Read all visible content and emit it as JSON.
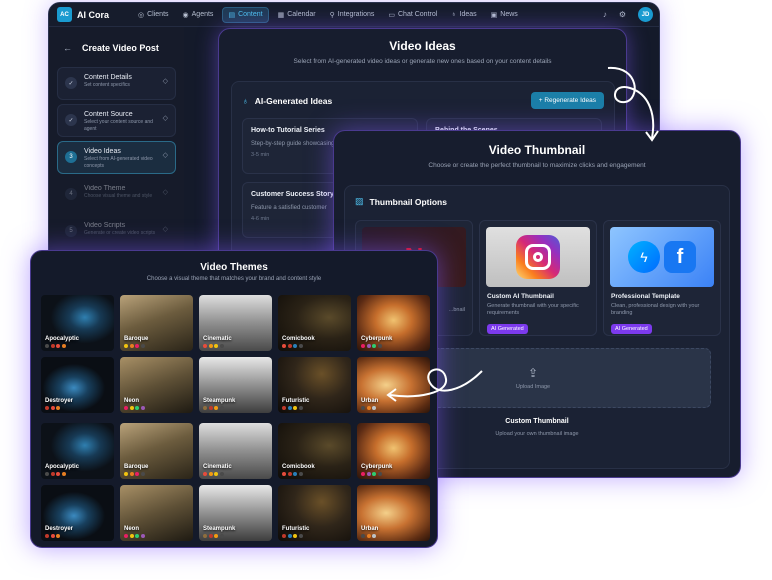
{
  "app": {
    "logo": "AC",
    "brand": "AI Cora",
    "nav": [
      {
        "label": "Clients",
        "icon": "users-icon",
        "glyph": "◎"
      },
      {
        "label": "Agents",
        "icon": "bot-icon",
        "glyph": "◉"
      },
      {
        "label": "Content",
        "icon": "file-icon",
        "glyph": "▤",
        "active": true
      },
      {
        "label": "Calendar",
        "icon": "calendar-icon",
        "glyph": "▦"
      },
      {
        "label": "Integrations",
        "icon": "plug-icon",
        "glyph": "⚲"
      },
      {
        "label": "Chat Control",
        "icon": "chat-icon",
        "glyph": "▭"
      },
      {
        "label": "Ideas",
        "icon": "lightbulb-icon",
        "glyph": "♁"
      },
      {
        "label": "News",
        "icon": "news-icon",
        "glyph": "▣"
      }
    ],
    "avatar": "JD"
  },
  "sidebar": {
    "title": "Create Video Post",
    "steps": [
      {
        "num": "✓",
        "title": "Content Details",
        "sub": "Set content specifics",
        "state": "done"
      },
      {
        "num": "✓",
        "title": "Content Source",
        "sub": "Select your content source and agent",
        "state": "done"
      },
      {
        "num": "3",
        "title": "Video Ideas",
        "sub": "Select from AI-generated video concepts",
        "state": "active"
      },
      {
        "num": "4",
        "title": "Video Theme",
        "sub": "Choose visual theme and style",
        "state": "pending"
      },
      {
        "num": "5",
        "title": "Video Scripts",
        "sub": "Generate or create video scripts",
        "state": "pending"
      }
    ]
  },
  "ideas": {
    "title": "Video Ideas",
    "subtitle": "Select from AI-generated video ideas or generate new ones based on your content details",
    "section_title": "AI-Generated Ideas",
    "regenerate": "Regenerate Ideas",
    "cards": [
      {
        "title": "How-to Tutorial Series",
        "desc": "Step-by-step guide showcasing your product or service",
        "meta": "3-5 min"
      },
      {
        "title": "Behind the Scenes",
        "desc": "",
        "meta": ""
      },
      {
        "title": "Customer Success Story",
        "desc": "Feature a satisfied customer",
        "meta": "4-6 min"
      }
    ]
  },
  "thumbnail": {
    "title": "Video Thumbnail",
    "subtitle": "Choose or create the perfect thumbnail to maximize clicks and engagement",
    "section_title": "Thumbnail Options",
    "options": [
      {
        "title": "",
        "desc": "...bnail",
        "badge": ""
      },
      {
        "title": "Custom AI Thumbnail",
        "desc": "Generate thumbnail with your specific requirements",
        "badge": "AI Generated"
      },
      {
        "title": "Professional Template",
        "desc": "Clean, professional design with your branding",
        "badge": "AI Generated"
      }
    ],
    "upload_label": "Upload Image",
    "custom_title": "Custom Thumbnail",
    "custom_sub": "Upload your own thumbnail image"
  },
  "themes": {
    "title": "Video Themes",
    "subtitle": "Choose a visual theme that matches your brand and content style",
    "tiles": [
      {
        "label": "Apocalyptic",
        "style": "apocalyptic",
        "dots": [
          "#4a4a4a",
          "#c0392b",
          "#e74c3c",
          "#e67e22"
        ]
      },
      {
        "label": "Baroque",
        "style": "baroque",
        "dots": [
          "#f1c40f",
          "#e67e22",
          "#e91e63",
          "#4a4a4a"
        ]
      },
      {
        "label": "Cinematic",
        "style": "cinematic",
        "dots": [
          "#e74c3c",
          "#f39c12",
          "#f1c40f",
          "#4a4a4a"
        ]
      },
      {
        "label": "Comicbook",
        "style": "comicbook",
        "dots": [
          "#e74c3c",
          "#c0392b",
          "#2980b9",
          "#4a4a4a"
        ]
      },
      {
        "label": "Cyberpunk",
        "style": "cyberpunk",
        "dots": [
          "#e91e63",
          "#9b59b6",
          "#2ecc71",
          "#4a4a4a"
        ]
      },
      {
        "label": "Destroyer",
        "style": "destroyer",
        "dots": [
          "#c0392b",
          "#e74c3c",
          "#e67e22"
        ]
      },
      {
        "label": "Neon",
        "style": "neon",
        "dots": [
          "#e91e63",
          "#f1c40f",
          "#2ecc71",
          "#9b59b6"
        ]
      },
      {
        "label": "Steampunk",
        "style": "steampunk",
        "dots": [
          "#8e6e3e",
          "#c0392b",
          "#f39c12",
          "#4a4a4a"
        ]
      },
      {
        "label": "Futuristic",
        "style": "futuristic",
        "dots": [
          "#c0392b",
          "#2980b9",
          "#f1c40f",
          "#4a4a4a"
        ]
      },
      {
        "label": "Urban",
        "style": "urban",
        "dots": [
          "#4a4a4a",
          "#e67e22",
          "#bdc3c7"
        ]
      },
      {
        "label": "Apocalyptic",
        "style": "apocalyptic",
        "dots": [
          "#4a4a4a",
          "#c0392b",
          "#e74c3c",
          "#e67e22"
        ]
      },
      {
        "label": "Baroque",
        "style": "baroque",
        "dots": [
          "#f1c40f",
          "#e67e22",
          "#e91e63",
          "#4a4a4a"
        ]
      },
      {
        "label": "Cinematic",
        "style": "cinematic",
        "dots": [
          "#e74c3c",
          "#f39c12",
          "#f1c40f",
          "#4a4a4a"
        ]
      },
      {
        "label": "Comicbook",
        "style": "comicbook",
        "dots": [
          "#e74c3c",
          "#c0392b",
          "#2980b9",
          "#4a4a4a"
        ]
      },
      {
        "label": "Cyberpunk",
        "style": "cyberpunk",
        "dots": [
          "#e91e63",
          "#9b59b6",
          "#2ecc71",
          "#4a4a4a"
        ]
      },
      {
        "label": "Destroyer",
        "style": "destroyer",
        "dots": [
          "#c0392b",
          "#e74c3c",
          "#e67e22"
        ]
      },
      {
        "label": "Neon",
        "style": "neon",
        "dots": [
          "#e91e63",
          "#f1c40f",
          "#2ecc71",
          "#9b59b6"
        ]
      },
      {
        "label": "Steampunk",
        "style": "steampunk",
        "dots": [
          "#8e6e3e",
          "#c0392b",
          "#f39c12",
          "#4a4a4a"
        ]
      },
      {
        "label": "Futuristic",
        "style": "futuristic",
        "dots": [
          "#c0392b",
          "#2980b9",
          "#f1c40f",
          "#4a4a4a"
        ]
      },
      {
        "label": "Urban",
        "style": "urban",
        "dots": [
          "#4a4a4a",
          "#e67e22",
          "#bdc3c7"
        ]
      }
    ]
  },
  "colors": {
    "accent": "#1a9bd0",
    "purple_glow": "#7c3aed"
  }
}
